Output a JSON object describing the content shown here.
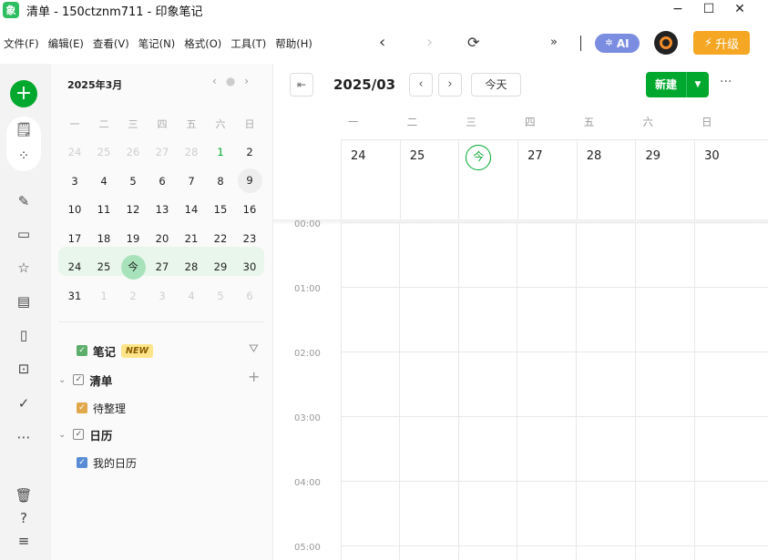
{
  "window": {
    "title": "清单 - 150ctznm711 - 印象笔记",
    "controls": [
      "−",
      "☐",
      "✕"
    ]
  },
  "menu": [
    "文件(F)",
    "编辑(E)",
    "查看(V)",
    "笔记(N)",
    "格式(O)",
    "工具(T)",
    "帮助(H)"
  ],
  "toolbar": {
    "ai_label": "AI",
    "upgrade_label": "升级"
  },
  "mini_calendar": {
    "title": "2025年3月",
    "weekdays": [
      "一",
      "二",
      "三",
      "四",
      "五",
      "六",
      "日"
    ],
    "weeks": [
      [
        "24",
        "25",
        "26",
        "27",
        "28",
        "1",
        "2"
      ],
      [
        "3",
        "4",
        "5",
        "6",
        "7",
        "8",
        "9"
      ],
      [
        "10",
        "11",
        "12",
        "13",
        "14",
        "15",
        "16"
      ],
      [
        "17",
        "18",
        "19",
        "20",
        "21",
        "22",
        "23"
      ],
      [
        "24",
        "25",
        "今",
        "27",
        "28",
        "29",
        "30"
      ],
      [
        "31",
        "1",
        "2",
        "3",
        "4",
        "5",
        "6"
      ]
    ]
  },
  "tree": {
    "notes_label": "笔记",
    "notes_badge": "NEW",
    "lists_label": "清单",
    "pending_label": "待整理",
    "calendar_label": "日历",
    "my_calendar_label": "我的日历"
  },
  "main": {
    "month_title": "2025/03",
    "today_label": "今天",
    "new_label": "新建",
    "week_headers": [
      "一",
      "二",
      "三",
      "四",
      "五",
      "六",
      "日"
    ],
    "dates": [
      "24",
      "25",
      "今",
      "27",
      "28",
      "29",
      "30"
    ],
    "times": [
      "00:00",
      "01:00",
      "02:00",
      "03:00",
      "04:00",
      "05:00"
    ]
  },
  "colors": {
    "accent": "#00a82d",
    "upgrade": "#f5a623",
    "ai": "#7b8de0"
  }
}
